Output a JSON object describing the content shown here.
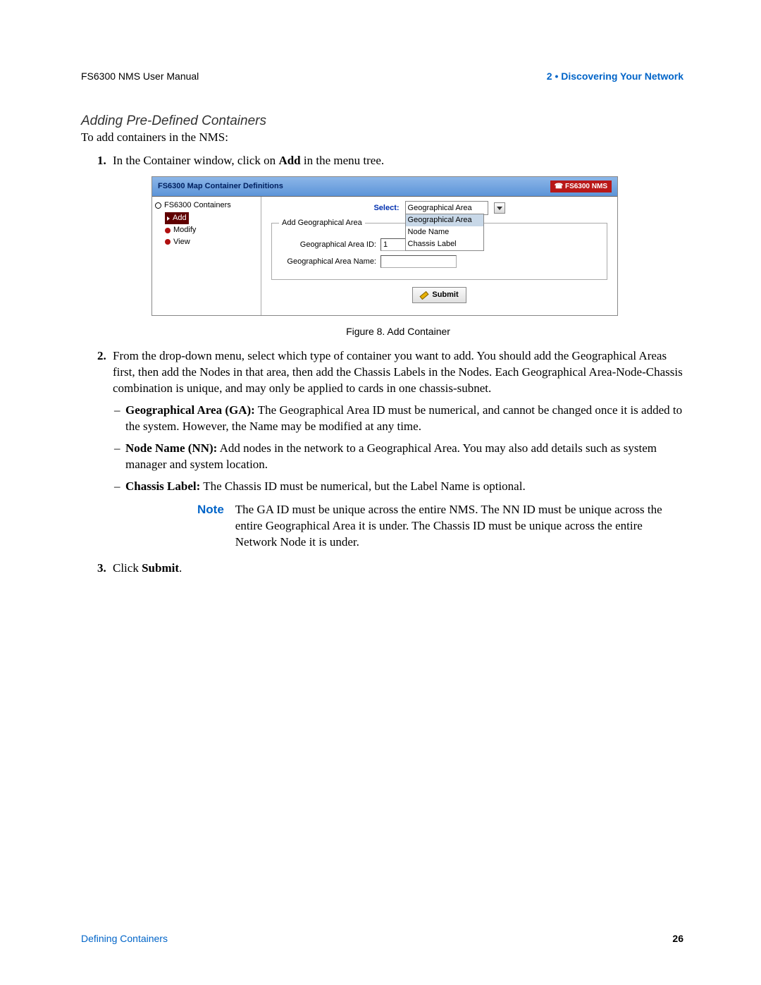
{
  "header": {
    "left": "FS6300 NMS User Manual",
    "right": "2 • Discovering Your Network"
  },
  "section_title": "Adding Pre-Defined Containers",
  "intro": "To add containers in the NMS:",
  "step1": {
    "prefix": "In the Container window, click on ",
    "bold": "Add",
    "suffix": " in the menu tree."
  },
  "screenshot": {
    "title": "FS6300 Map Container Definitions",
    "badge": "FS6300 NMS",
    "tree": {
      "root": "FS6300 Containers",
      "items": [
        "Add",
        "Modify",
        "View"
      ],
      "selected": "Add"
    },
    "form": {
      "select_label": "Select:",
      "selected_value": "Geographical Area",
      "dropdown_options": [
        "Geographical Area",
        "Node Name",
        "Chassis Label"
      ],
      "fieldset_legend": "Add Geographical Area",
      "id_label": "Geographical Area ID:",
      "id_value": "1",
      "name_label": "Geographical Area Name:",
      "name_value": "",
      "submit": "Submit"
    }
  },
  "figure_caption": "Figure 8. Add Container",
  "step2": {
    "text": "From the drop-down menu, select which type of container you want to add. You should add the Geographical Areas first, then add the Nodes in that area, then add the Chassis Labels in the Nodes. Each Geographical Area-Node-Chassis combination is unique, and may only be applied to cards in one chassis-subnet.",
    "bullets": {
      "ga_bold": "Geographical Area (GA):",
      "ga_text": " The Geographical Area ID must be numerical, and cannot be changed once it is added to the system. However, the Name may be modified at any time.",
      "nn_bold": "Node Name (NN):",
      "nn_text": " Add nodes in the network to a Geographical Area. You may also add details such as system manager and system location.",
      "cl_bold": "Chassis Label:",
      "cl_text": " The Chassis ID must be numerical, but the Label Name is optional."
    }
  },
  "note": {
    "label": "Note",
    "text": "The GA ID must be unique across the entire NMS. The NN ID must be unique across the entire Geographical Area it is under. The Chassis ID must be unique across the entire Network Node it is under."
  },
  "step3": {
    "prefix": "Click ",
    "bold": "Submit",
    "suffix": "."
  },
  "footer": {
    "left": "Defining Containers",
    "right": "26"
  }
}
